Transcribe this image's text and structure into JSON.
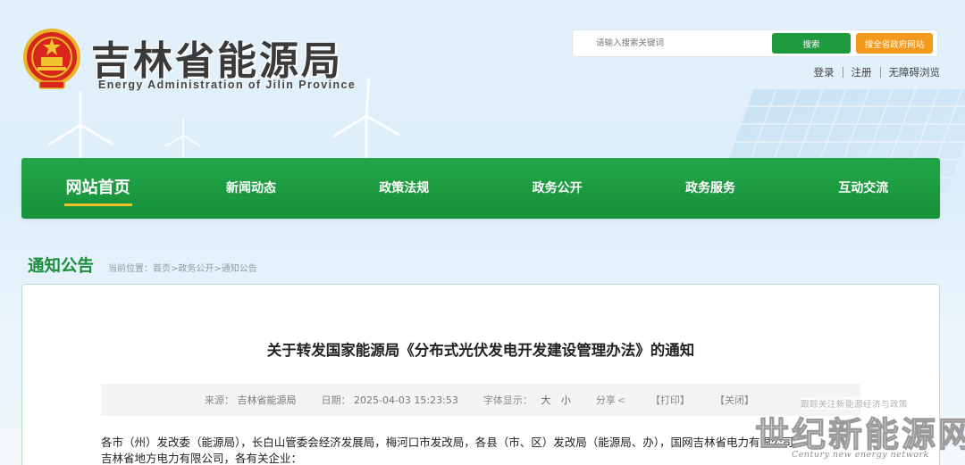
{
  "header": {
    "title": "吉林省能源局",
    "subtitle": "Energy Administration of Jilin Province"
  },
  "search": {
    "placeholder": "请输入搜索关键词",
    "button_label": "搜索",
    "gov_button_label": "搜全省政府网站"
  },
  "top_links": [
    "登录",
    "注册",
    "无障碍浏览"
  ],
  "nav": {
    "items": [
      {
        "label": "网站首页",
        "active": true
      },
      {
        "label": "新闻动态"
      },
      {
        "label": "政策法规"
      },
      {
        "label": "政务公开"
      },
      {
        "label": "政务服务"
      },
      {
        "label": "互动交流"
      }
    ]
  },
  "section": {
    "title": "通知公告",
    "breadcrumb": "当前位置：首页>政务公开>通知公告"
  },
  "article": {
    "title": "关于转发国家能源局《分布式光伏发电开发建设管理办法》的通知",
    "meta": {
      "source_label": "来源：",
      "source_value": "吉林省能源局",
      "date_label": "日期：",
      "date_value": "2025-04-03 15:23:53",
      "font_label": "字体显示：",
      "font_large": "大",
      "font_small": "小",
      "share_label": "分享",
      "print_label": "【打印】",
      "close_label": "【关闭】"
    },
    "body_line1": "各市（州）发改委（能源局），长白山管委会经济发展局，梅河口市发改局，各县（市、区）发改局（能源局、办），国网吉林省电力有限公司，",
    "body_line2": "吉林省地方电力有限公司，各有关企业："
  },
  "watermark": {
    "follow": "跟踪关注新能源经济与政策",
    "big": "世纪新能源网",
    "en": "Century new energy network"
  },
  "colors": {
    "brand_green": "#1b8e3a",
    "search_green": "#1e9b3f",
    "orange": "#f29a1d",
    "active_underline": "#f3c22b"
  }
}
